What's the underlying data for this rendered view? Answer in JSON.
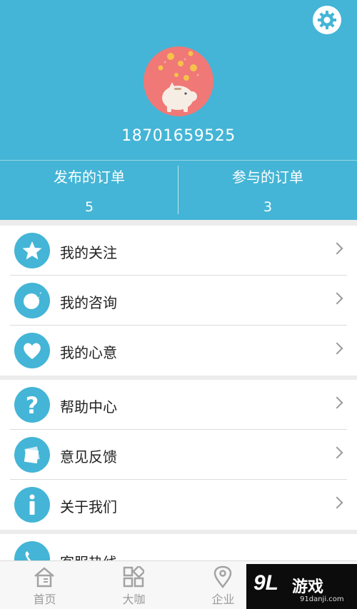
{
  "profile": {
    "phone": "18701659525",
    "settings_icon": "gear-icon",
    "avatar_icon": "piggy-bank-avatar"
  },
  "stats": {
    "published_label": "发布的订单",
    "published_count": "5",
    "joined_label": "参与的订单",
    "joined_count": "3"
  },
  "menu_groups": [
    {
      "items": [
        {
          "label": "我的关注",
          "icon": "star-icon"
        },
        {
          "label": "我的咨询",
          "icon": "chat-bubble-icon"
        },
        {
          "label": "我的心意",
          "icon": "heart-icon"
        }
      ]
    },
    {
      "items": [
        {
          "label": "帮助中心",
          "icon": "question-icon"
        },
        {
          "label": "意见反馈",
          "icon": "feedback-icon"
        },
        {
          "label": "关于我们",
          "icon": "info-icon"
        }
      ]
    },
    {
      "items": [
        {
          "label": "客服热线",
          "icon": "phone-icon"
        }
      ]
    }
  ],
  "tabbar": {
    "tabs": [
      {
        "label": "首页",
        "icon": "home-icon"
      },
      {
        "label": "大咖",
        "icon": "grid-icon"
      },
      {
        "label": "企业",
        "icon": "location-pin-icon"
      }
    ]
  },
  "watermark": {
    "logo": "9L",
    "name": "游戏",
    "url": "91danji.com"
  },
  "colors": {
    "accent": "#44b5d6",
    "background": "#ececec",
    "avatar_bg": "#f07877"
  }
}
